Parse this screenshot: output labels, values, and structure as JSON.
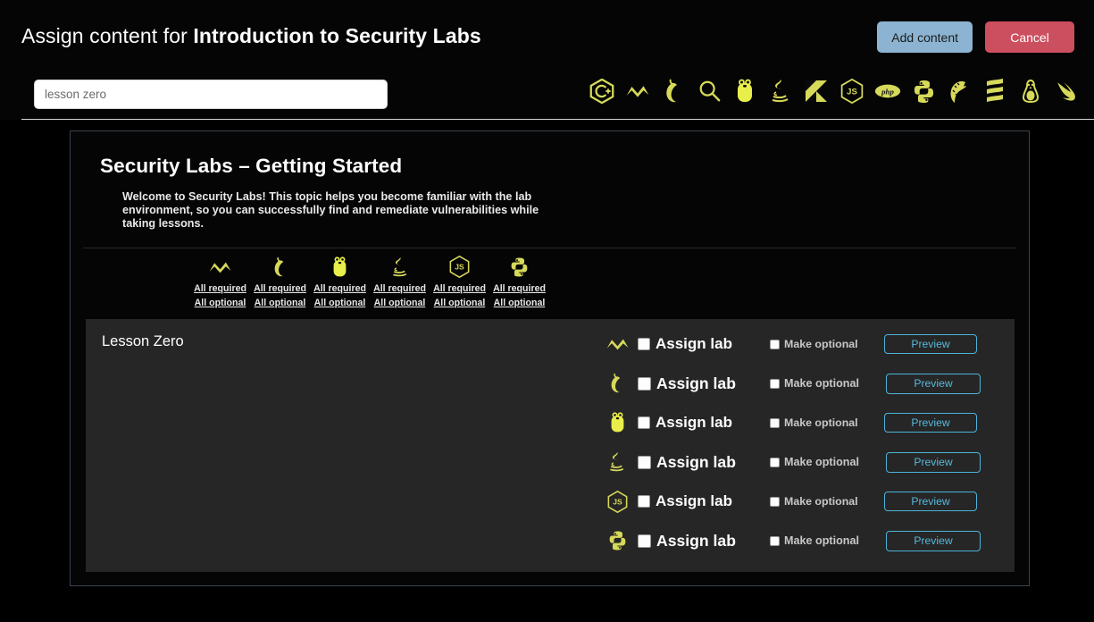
{
  "header": {
    "title_prefix": "Assign content for ",
    "title_strong": "Introduction to Security Labs",
    "add_content_label": "Add content",
    "cancel_label": "Cancel",
    "search_value": "lesson zero",
    "search_placeholder": "lesson zero",
    "languages": [
      {
        "icon": "csharp-icon",
        "name": "C#"
      },
      {
        "icon": "nim-icon",
        "name": "Nim"
      },
      {
        "icon": "chili-pepper-icon",
        "name": "Pepper"
      },
      {
        "icon": "magnifier-icon",
        "name": "Search"
      },
      {
        "icon": "go-gopher-icon",
        "name": "Go"
      },
      {
        "icon": "java-icon",
        "name": "Java"
      },
      {
        "icon": "kotlin-icon",
        "name": "Kotlin"
      },
      {
        "icon": "nodejs-icon",
        "name": "Node.js"
      },
      {
        "icon": "php-icon",
        "name": "PHP"
      },
      {
        "icon": "python-icon",
        "name": "Python"
      },
      {
        "icon": "ruby-icon",
        "name": "Ruby"
      },
      {
        "icon": "scala-icon",
        "name": "Scala"
      },
      {
        "icon": "linux-tux-icon",
        "name": "Linux"
      },
      {
        "icon": "swift-icon",
        "name": "Swift"
      }
    ]
  },
  "topic": {
    "title": "Security Labs – Getting Started",
    "description": "Welcome to Security Labs! This topic helps you become familiar with the lab environment, so you can successfully find and remediate vulnerabilities while taking lessons.",
    "bulk_columns": [
      {
        "icon": "nim-icon",
        "required_label": "All required",
        "optional_label": "All optional"
      },
      {
        "icon": "chili-pepper-icon",
        "required_label": "All required",
        "optional_label": "All optional"
      },
      {
        "icon": "go-gopher-icon",
        "required_label": "All required",
        "optional_label": "All optional"
      },
      {
        "icon": "java-icon",
        "required_label": "All required",
        "optional_label": "All optional"
      },
      {
        "icon": "nodejs-icon",
        "required_label": "All required",
        "optional_label": "All optional"
      },
      {
        "icon": "python-icon",
        "required_label": "All required",
        "optional_label": "All optional"
      }
    ]
  },
  "lesson": {
    "title": "Lesson Zero",
    "rows": [
      {
        "icon": "nim-icon",
        "assign_label": "Assign lab",
        "optional_label": "Make optional",
        "preview_label": "Preview",
        "assign_checked": false,
        "optional_checked": false
      },
      {
        "icon": "chili-pepper-icon",
        "assign_label": "Assign lab",
        "optional_label": "Make optional",
        "preview_label": "Preview",
        "assign_checked": false,
        "optional_checked": false
      },
      {
        "icon": "go-gopher-icon",
        "assign_label": "Assign lab",
        "optional_label": "Make optional",
        "preview_label": "Preview",
        "assign_checked": false,
        "optional_checked": false
      },
      {
        "icon": "java-icon",
        "assign_label": "Assign lab",
        "optional_label": "Make optional",
        "preview_label": "Preview",
        "assign_checked": false,
        "optional_checked": false
      },
      {
        "icon": "nodejs-icon",
        "assign_label": "Assign lab",
        "optional_label": "Make optional",
        "preview_label": "Preview",
        "assign_checked": false,
        "optional_checked": false
      },
      {
        "icon": "python-icon",
        "assign_label": "Assign lab",
        "optional_label": "Make optional",
        "preview_label": "Preview",
        "assign_checked": false,
        "optional_checked": false
      }
    ]
  },
  "colors": {
    "page_background": "#000000",
    "panel_background": "#262626",
    "accent_yellow": "#d6d95a",
    "add_button": "#8cb4d2",
    "cancel_button": "#cc4f5f",
    "preview_accent": "#57b9dc",
    "card_border": "#3b4450"
  }
}
